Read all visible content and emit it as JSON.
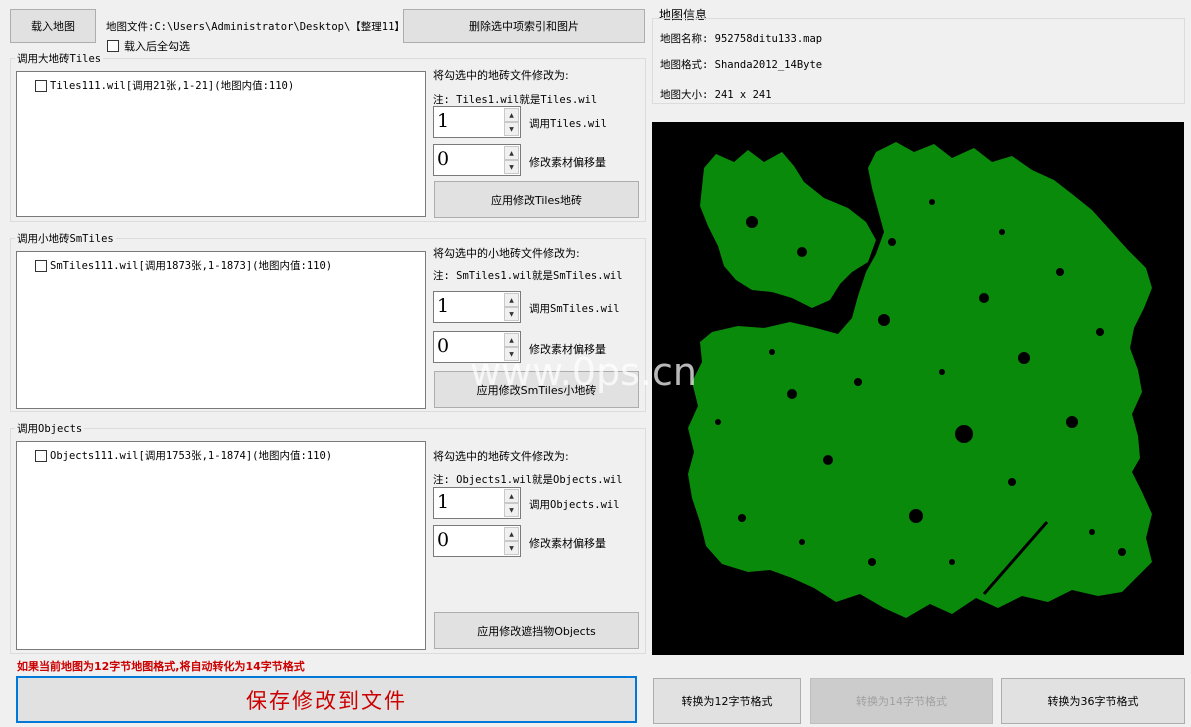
{
  "toolbar": {
    "load_map_label": "载入地图",
    "map_file_text": "地图文件:C:\\Users\\Administrator\\Desktop\\【整理11】",
    "delete_label": "删除选中项索引和图片",
    "check_all_label": "载入后全勾选"
  },
  "tiles": {
    "group_title": "调用大地砖Tiles",
    "item_label": "Tiles111.wil[调用21张,1-21](地图内值:110)",
    "modify_label": "将勾选中的地砖文件修改为:",
    "note": "注: Tiles1.wil就是Tiles.wil",
    "spin1_value": "1",
    "spin1_label": "调用Tiles.wil",
    "spin2_value": "0",
    "spin2_label": "修改素材偏移量",
    "apply_label": "应用修改Tiles地砖"
  },
  "smtiles": {
    "group_title": "调用小地砖SmTiles",
    "item_label": "SmTiles111.wil[调用1873张,1-1873](地图内值:110)",
    "modify_label": "将勾选中的小地砖文件修改为:",
    "note": "注: SmTiles1.wil就是SmTiles.wil",
    "spin1_value": "1",
    "spin1_label": "调用SmTiles.wil",
    "spin2_value": "0",
    "spin2_label": "修改素材偏移量",
    "apply_label": "应用修改SmTiles小地砖"
  },
  "objects": {
    "group_title": "调用Objects",
    "item_label": "Objects111.wil[调用1753张,1-1874](地图内值:110)",
    "modify_label": "将勾选中的地砖文件修改为:",
    "note": "注: Objects1.wil就是Objects.wil",
    "spin1_value": "1",
    "spin1_label": "调用Objects.wil",
    "spin2_value": "0",
    "spin2_label": "修改素材偏移量",
    "apply_label": "应用修改遮挡物Objects"
  },
  "warning_text": "如果当前地图为12字节地图格式,将自动转化为14字节格式",
  "save_label": "保存修改到文件",
  "info": {
    "title": "地图信息",
    "name": "地图名称: 952758ditu133.map",
    "format": "地图格式: Shanda2012_14Byte",
    "size": "地图大小: 241 x 241"
  },
  "convert": {
    "to12": "转换为12字节格式",
    "to14": "转换为14字节格式",
    "to36": "转换为36字节格式"
  },
  "watermark": "www.0ps.cn",
  "colors": {
    "map_bg": "#000000",
    "map_land": "#0a8a0a",
    "warning": "#cc0000",
    "save_text": "#cc0000",
    "save_border": "#0078d7"
  }
}
